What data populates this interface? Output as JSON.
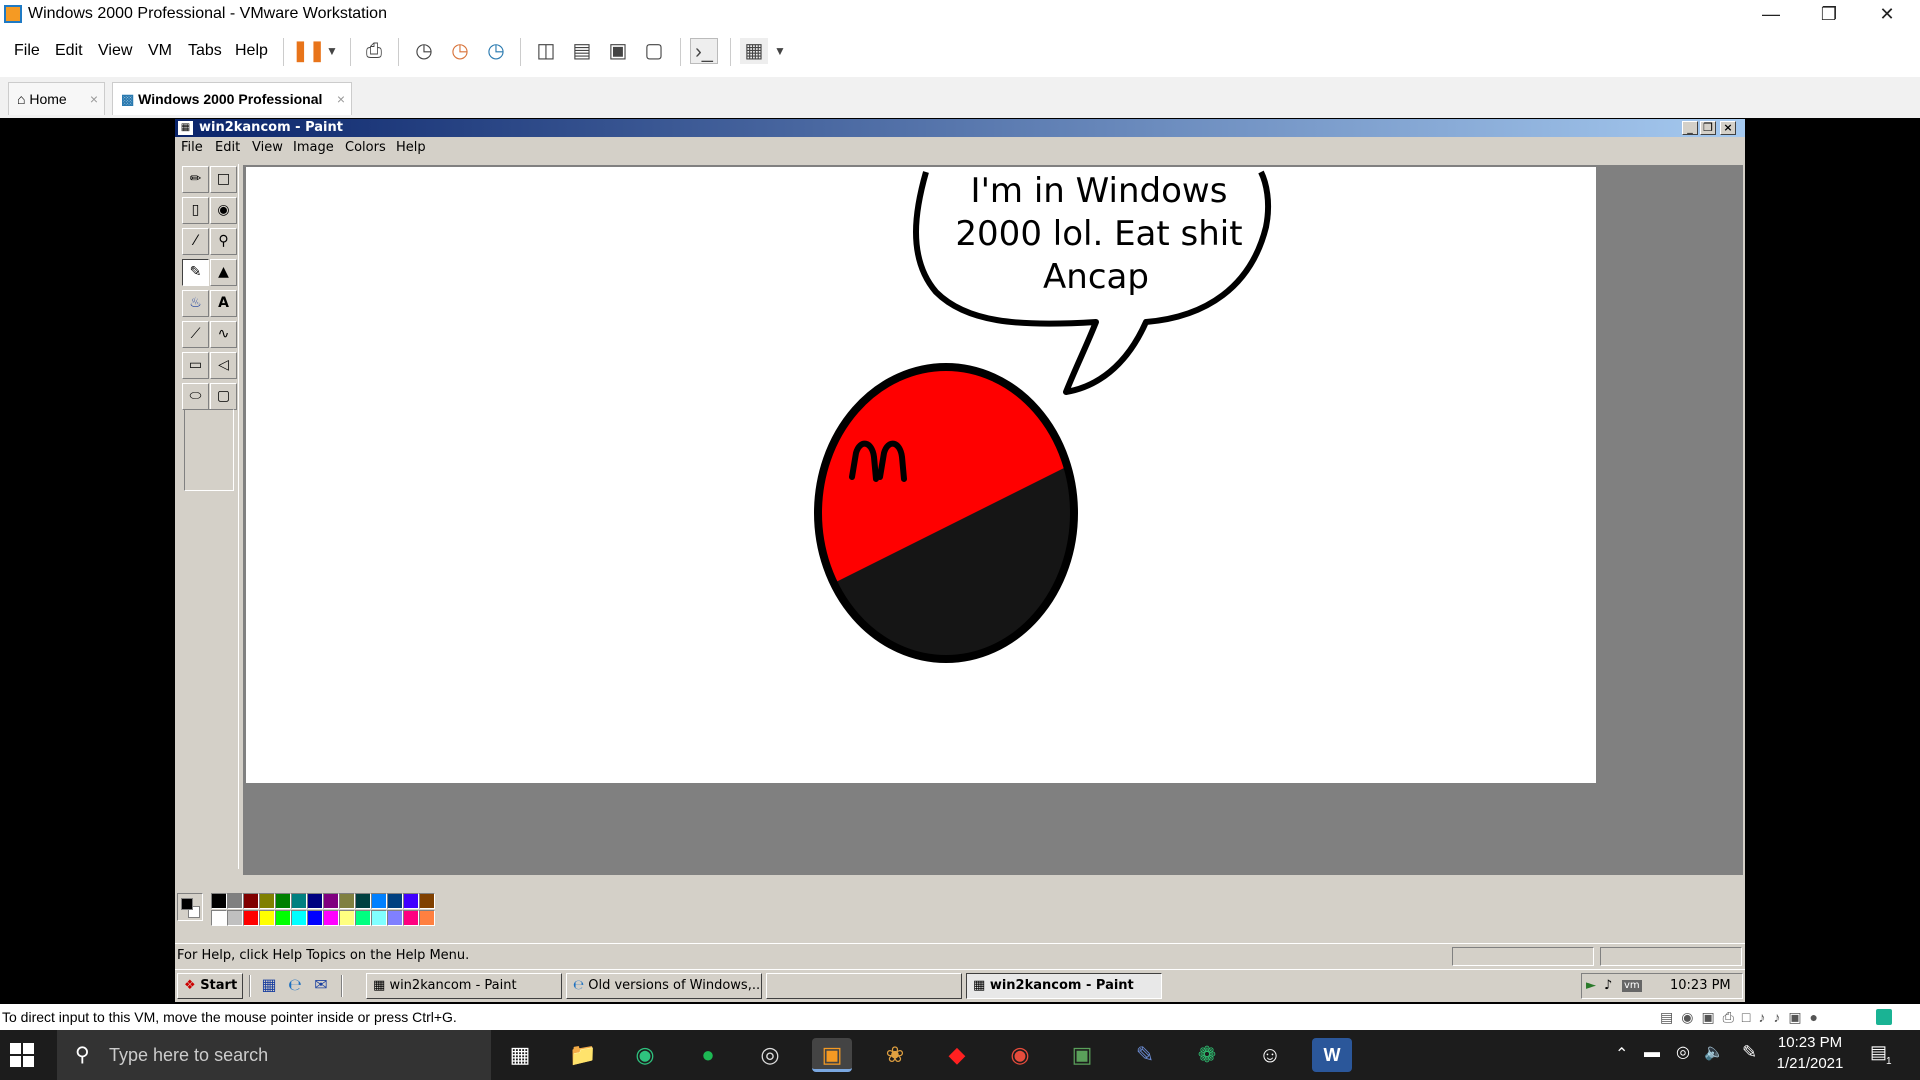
{
  "window": {
    "title": "Windows 2000 Professional - VMware Workstation",
    "minimize_icon": "minimize-icon",
    "restore_icon": "restore-icon",
    "close_icon": "close-icon"
  },
  "menu": {
    "items": [
      "File",
      "Edit",
      "View",
      "VM",
      "Tabs",
      "Help"
    ]
  },
  "tabs": [
    {
      "label": "Home",
      "active": false
    },
    {
      "label": "Windows 2000 Professional",
      "active": true
    }
  ],
  "paint": {
    "title": "win2kancom - Paint",
    "menu": [
      "File",
      "Edit",
      "View",
      "Image",
      "Colors",
      "Help"
    ],
    "speech": [
      "I'm in Windows",
      "2000 lol. Eat shit",
      "Ancap"
    ],
    "ball_colors": {
      "top": "#ff0000",
      "bottom": "#151515",
      "outline": "#000000"
    },
    "status_text": "For Help, click Help Topics on the Help Menu.",
    "palette_top": [
      "#000000",
      "#808080",
      "#800000",
      "#808000",
      "#008000",
      "#008080",
      "#000080",
      "#800080",
      "#808040",
      "#004040",
      "#0080ff",
      "#004080",
      "#4000ff",
      "#804000"
    ],
    "palette_bottom": [
      "#ffffff",
      "#c0c0c0",
      "#ff0000",
      "#ffff00",
      "#00ff00",
      "#00ffff",
      "#0000ff",
      "#ff00ff",
      "#ffff80",
      "#00ff80",
      "#80ffff",
      "#8080ff",
      "#ff0080",
      "#ff8040"
    ]
  },
  "w2k_taskbar": {
    "start": "Start",
    "buttons": [
      "win2kancom - Paint",
      "Old versions of Windows,...",
      "",
      "win2kancom - Paint"
    ],
    "clock": "10:23 PM"
  },
  "vm_status": "To direct input to this VM, move the mouse pointer inside or press Ctrl+G.",
  "taskbar": {
    "search_placeholder": "Type here to search",
    "time": "10:23 PM",
    "date": "1/21/2021",
    "notification_count": "1"
  }
}
